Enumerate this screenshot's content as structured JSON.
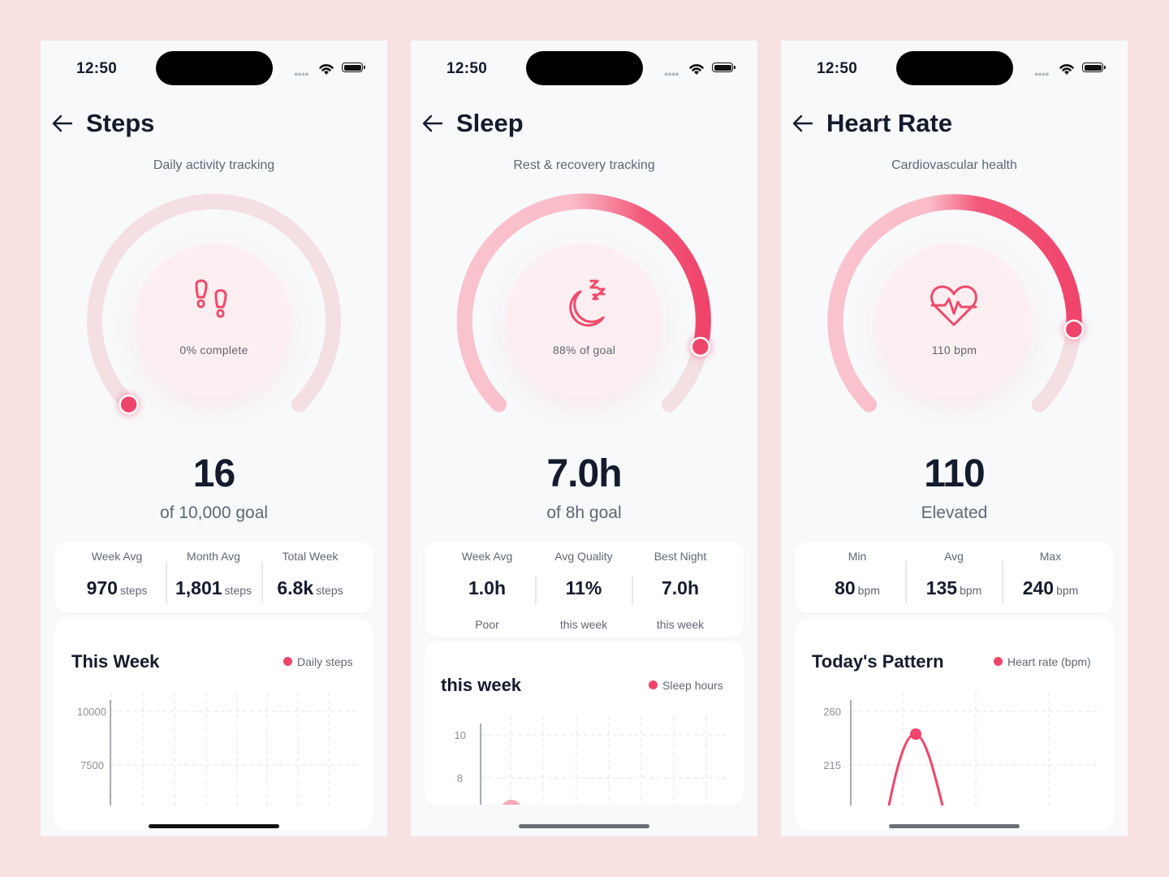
{
  "status": {
    "time": "12:50"
  },
  "steps": {
    "title": "Steps",
    "subtitle": "Daily activity tracking",
    "icon": "footprints-icon",
    "caption": "0% complete",
    "progress": 0.0,
    "value": "16",
    "value_sub": "of 10,000 goal",
    "stats": [
      {
        "label": "Week Avg",
        "value": "970",
        "unit": "steps"
      },
      {
        "label": "Month Avg",
        "value": "1,801",
        "unit": "steps"
      },
      {
        "label": "Total Week",
        "value": "6.8k",
        "unit": "steps"
      }
    ],
    "chart_title": "This Week",
    "legend": "Daily steps",
    "yticks": [
      "10000",
      "7500"
    ]
  },
  "sleep": {
    "title": "Sleep",
    "subtitle": "Rest & recovery tracking",
    "icon": "moon-sleep-icon",
    "caption": "88% of goal",
    "progress": 0.88,
    "value": "7.0h",
    "value_sub": "of 8h goal",
    "stats": [
      {
        "label": "Week Avg",
        "value": "1.0h",
        "note": "Poor"
      },
      {
        "label": "Avg Quality",
        "value": "11%",
        "note": "this week"
      },
      {
        "label": "Best Night",
        "value": "7.0h",
        "note": "this week"
      }
    ],
    "chart_title": "this week",
    "legend": "Sleep hours",
    "yticks": [
      "10",
      "8"
    ]
  },
  "heart": {
    "title": "Heart Rate",
    "subtitle": "Cardiovascular health",
    "icon": "heart-pulse-icon",
    "caption": "110 bpm",
    "progress": 0.72,
    "value": "110",
    "value_sub": "Elevated",
    "stats": [
      {
        "label": "Min",
        "value": "80",
        "unit": "bpm"
      },
      {
        "label": "Avg",
        "value": "135",
        "unit": "bpm"
      },
      {
        "label": "Max",
        "value": "240",
        "unit": "bpm"
      }
    ],
    "chart_title": "Today's Pattern",
    "legend": "Heart rate (bpm)",
    "yticks": [
      "260",
      "215"
    ]
  },
  "colors": {
    "accent": "#f0456b",
    "accent_light": "#f9bfca",
    "track": "#f4dfe2",
    "background": "#f8e1e1"
  },
  "chart_data": [
    {
      "type": "line",
      "title": "This Week",
      "series": [
        {
          "name": "Daily steps",
          "values": []
        }
      ],
      "yticks": [
        10000,
        7500
      ],
      "grid": true,
      "legend": "top-right"
    },
    {
      "type": "line",
      "title": "this week",
      "series": [
        {
          "name": "Sleep hours",
          "values": [
            6.5
          ]
        }
      ],
      "yticks": [
        10,
        8
      ],
      "grid": true,
      "legend": "top-right"
    },
    {
      "type": "line",
      "title": "Today's Pattern",
      "series": [
        {
          "name": "Heart rate (bpm)",
          "values": [
            240
          ]
        }
      ],
      "yticks": [
        260,
        215
      ],
      "grid": true,
      "legend": "top-right"
    }
  ]
}
